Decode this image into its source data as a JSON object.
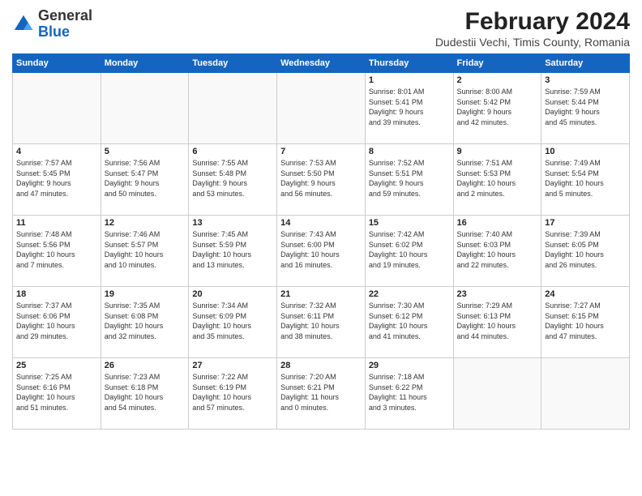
{
  "header": {
    "logo_general": "General",
    "logo_blue": "Blue",
    "month_year": "February 2024",
    "location": "Dudestii Vechi, Timis County, Romania"
  },
  "days_of_week": [
    "Sunday",
    "Monday",
    "Tuesday",
    "Wednesday",
    "Thursday",
    "Friday",
    "Saturday"
  ],
  "weeks": [
    [
      {
        "day": "",
        "info": ""
      },
      {
        "day": "",
        "info": ""
      },
      {
        "day": "",
        "info": ""
      },
      {
        "day": "",
        "info": ""
      },
      {
        "day": "1",
        "info": "Sunrise: 8:01 AM\nSunset: 5:41 PM\nDaylight: 9 hours\nand 39 minutes."
      },
      {
        "day": "2",
        "info": "Sunrise: 8:00 AM\nSunset: 5:42 PM\nDaylight: 9 hours\nand 42 minutes."
      },
      {
        "day": "3",
        "info": "Sunrise: 7:59 AM\nSunset: 5:44 PM\nDaylight: 9 hours\nand 45 minutes."
      }
    ],
    [
      {
        "day": "4",
        "info": "Sunrise: 7:57 AM\nSunset: 5:45 PM\nDaylight: 9 hours\nand 47 minutes."
      },
      {
        "day": "5",
        "info": "Sunrise: 7:56 AM\nSunset: 5:47 PM\nDaylight: 9 hours\nand 50 minutes."
      },
      {
        "day": "6",
        "info": "Sunrise: 7:55 AM\nSunset: 5:48 PM\nDaylight: 9 hours\nand 53 minutes."
      },
      {
        "day": "7",
        "info": "Sunrise: 7:53 AM\nSunset: 5:50 PM\nDaylight: 9 hours\nand 56 minutes."
      },
      {
        "day": "8",
        "info": "Sunrise: 7:52 AM\nSunset: 5:51 PM\nDaylight: 9 hours\nand 59 minutes."
      },
      {
        "day": "9",
        "info": "Sunrise: 7:51 AM\nSunset: 5:53 PM\nDaylight: 10 hours\nand 2 minutes."
      },
      {
        "day": "10",
        "info": "Sunrise: 7:49 AM\nSunset: 5:54 PM\nDaylight: 10 hours\nand 5 minutes."
      }
    ],
    [
      {
        "day": "11",
        "info": "Sunrise: 7:48 AM\nSunset: 5:56 PM\nDaylight: 10 hours\nand 7 minutes."
      },
      {
        "day": "12",
        "info": "Sunrise: 7:46 AM\nSunset: 5:57 PM\nDaylight: 10 hours\nand 10 minutes."
      },
      {
        "day": "13",
        "info": "Sunrise: 7:45 AM\nSunset: 5:59 PM\nDaylight: 10 hours\nand 13 minutes."
      },
      {
        "day": "14",
        "info": "Sunrise: 7:43 AM\nSunset: 6:00 PM\nDaylight: 10 hours\nand 16 minutes."
      },
      {
        "day": "15",
        "info": "Sunrise: 7:42 AM\nSunset: 6:02 PM\nDaylight: 10 hours\nand 19 minutes."
      },
      {
        "day": "16",
        "info": "Sunrise: 7:40 AM\nSunset: 6:03 PM\nDaylight: 10 hours\nand 22 minutes."
      },
      {
        "day": "17",
        "info": "Sunrise: 7:39 AM\nSunset: 6:05 PM\nDaylight: 10 hours\nand 26 minutes."
      }
    ],
    [
      {
        "day": "18",
        "info": "Sunrise: 7:37 AM\nSunset: 6:06 PM\nDaylight: 10 hours\nand 29 minutes."
      },
      {
        "day": "19",
        "info": "Sunrise: 7:35 AM\nSunset: 6:08 PM\nDaylight: 10 hours\nand 32 minutes."
      },
      {
        "day": "20",
        "info": "Sunrise: 7:34 AM\nSunset: 6:09 PM\nDaylight: 10 hours\nand 35 minutes."
      },
      {
        "day": "21",
        "info": "Sunrise: 7:32 AM\nSunset: 6:11 PM\nDaylight: 10 hours\nand 38 minutes."
      },
      {
        "day": "22",
        "info": "Sunrise: 7:30 AM\nSunset: 6:12 PM\nDaylight: 10 hours\nand 41 minutes."
      },
      {
        "day": "23",
        "info": "Sunrise: 7:29 AM\nSunset: 6:13 PM\nDaylight: 10 hours\nand 44 minutes."
      },
      {
        "day": "24",
        "info": "Sunrise: 7:27 AM\nSunset: 6:15 PM\nDaylight: 10 hours\nand 47 minutes."
      }
    ],
    [
      {
        "day": "25",
        "info": "Sunrise: 7:25 AM\nSunset: 6:16 PM\nDaylight: 10 hours\nand 51 minutes."
      },
      {
        "day": "26",
        "info": "Sunrise: 7:23 AM\nSunset: 6:18 PM\nDaylight: 10 hours\nand 54 minutes."
      },
      {
        "day": "27",
        "info": "Sunrise: 7:22 AM\nSunset: 6:19 PM\nDaylight: 10 hours\nand 57 minutes."
      },
      {
        "day": "28",
        "info": "Sunrise: 7:20 AM\nSunset: 6:21 PM\nDaylight: 11 hours\nand 0 minutes."
      },
      {
        "day": "29",
        "info": "Sunrise: 7:18 AM\nSunset: 6:22 PM\nDaylight: 11 hours\nand 3 minutes."
      },
      {
        "day": "",
        "info": ""
      },
      {
        "day": "",
        "info": ""
      }
    ]
  ]
}
